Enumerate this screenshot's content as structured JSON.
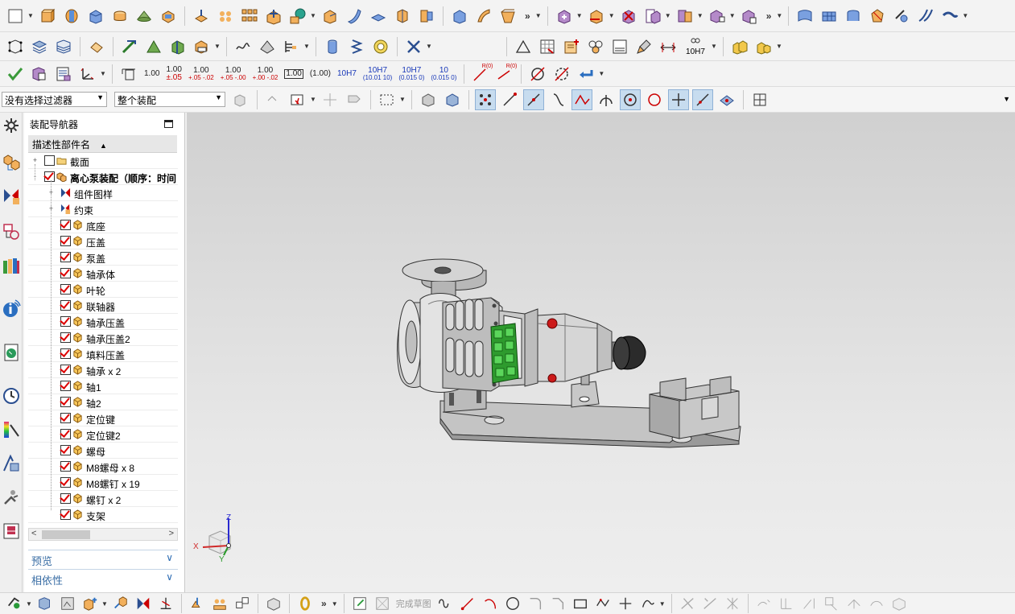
{
  "filters": {
    "selection_filter": "没有选择过滤器",
    "scope": "整个装配"
  },
  "dimension_buttons": [
    {
      "main": "1.00",
      "sub": ""
    },
    {
      "main": "1.00",
      "sub": "±.05"
    },
    {
      "main": "1.00",
      "sub": "+.05 -.02"
    },
    {
      "main": "1.00",
      "sub": "+.05 -.00"
    },
    {
      "main": "1.00",
      "sub": "+.00 -.02"
    },
    {
      "main": "1.00",
      "sub": "boxed"
    },
    {
      "main": "(1.00)",
      "sub": ""
    },
    {
      "main": "10H7",
      "sub": ""
    },
    {
      "main": "10H7",
      "sub": "(10.01 10)"
    },
    {
      "main": "10H7",
      "sub": "(0.015 0)"
    },
    {
      "main": "10",
      "sub": "(0.015 0)"
    }
  ],
  "toolbar_text": {
    "fit_label": "10H7",
    "finish_sketch": "完成草图",
    "r_label_1": "R(0)",
    "r_label_2": "R(0)"
  },
  "navigator": {
    "title": "装配导航器",
    "column_header": "描述性部件名",
    "nodes": [
      {
        "label": "截面",
        "level": 0,
        "checked": false,
        "icon": "folder-icon",
        "expander": "+"
      },
      {
        "label": "离心泵装配（顺序：时间",
        "level": 0,
        "checked": true,
        "icon": "assembly-icon",
        "expander": "-",
        "bold": true
      },
      {
        "label": "组件图样",
        "level": 1,
        "checked": null,
        "icon": "component-pattern-icon",
        "expander": "+"
      },
      {
        "label": "约束",
        "level": 1,
        "checked": null,
        "icon": "constraint-icon",
        "expander": "+"
      },
      {
        "label": "底座",
        "level": 1,
        "checked": true,
        "icon": "part-icon"
      },
      {
        "label": "压盖",
        "level": 1,
        "checked": true,
        "icon": "part-icon"
      },
      {
        "label": "泵盖",
        "level": 1,
        "checked": true,
        "icon": "part-icon"
      },
      {
        "label": "轴承体",
        "level": 1,
        "checked": true,
        "icon": "part-icon"
      },
      {
        "label": "叶轮",
        "level": 1,
        "checked": true,
        "icon": "part-icon"
      },
      {
        "label": "联轴器",
        "level": 1,
        "checked": true,
        "icon": "part-icon"
      },
      {
        "label": "轴承压盖",
        "level": 1,
        "checked": true,
        "icon": "part-icon"
      },
      {
        "label": "轴承压盖2",
        "level": 1,
        "checked": true,
        "icon": "part-icon"
      },
      {
        "label": "填料压盖",
        "level": 1,
        "checked": true,
        "icon": "part-icon"
      },
      {
        "label": "轴承 x 2",
        "level": 1,
        "checked": true,
        "icon": "part-icon"
      },
      {
        "label": "轴1",
        "level": 1,
        "checked": true,
        "icon": "part-icon"
      },
      {
        "label": "轴2",
        "level": 1,
        "checked": true,
        "icon": "part-icon"
      },
      {
        "label": "定位键",
        "level": 1,
        "checked": true,
        "icon": "part-icon"
      },
      {
        "label": "定位键2",
        "level": 1,
        "checked": true,
        "icon": "part-icon"
      },
      {
        "label": "螺母",
        "level": 1,
        "checked": true,
        "icon": "part-icon"
      },
      {
        "label": "M8螺母 x 8",
        "level": 1,
        "checked": true,
        "icon": "part-icon"
      },
      {
        "label": "M8螺钉 x 19",
        "level": 1,
        "checked": true,
        "icon": "part-icon"
      },
      {
        "label": "螺钉 x 2",
        "level": 1,
        "checked": true,
        "icon": "part-icon"
      },
      {
        "label": "支架",
        "level": 1,
        "checked": true,
        "icon": "part-icon"
      }
    ],
    "sections": [
      {
        "label": "预览"
      },
      {
        "label": "相依性"
      }
    ]
  },
  "triad": {
    "x": "X",
    "y": "Y",
    "z": "Z"
  },
  "colors": {
    "viewport_top": "#d0d0d0",
    "viewport_bottom": "#eeeeee",
    "highlight_green": "#2e9b2e",
    "check_red": "#dd0000",
    "section_blue": "#3a6ea5"
  }
}
